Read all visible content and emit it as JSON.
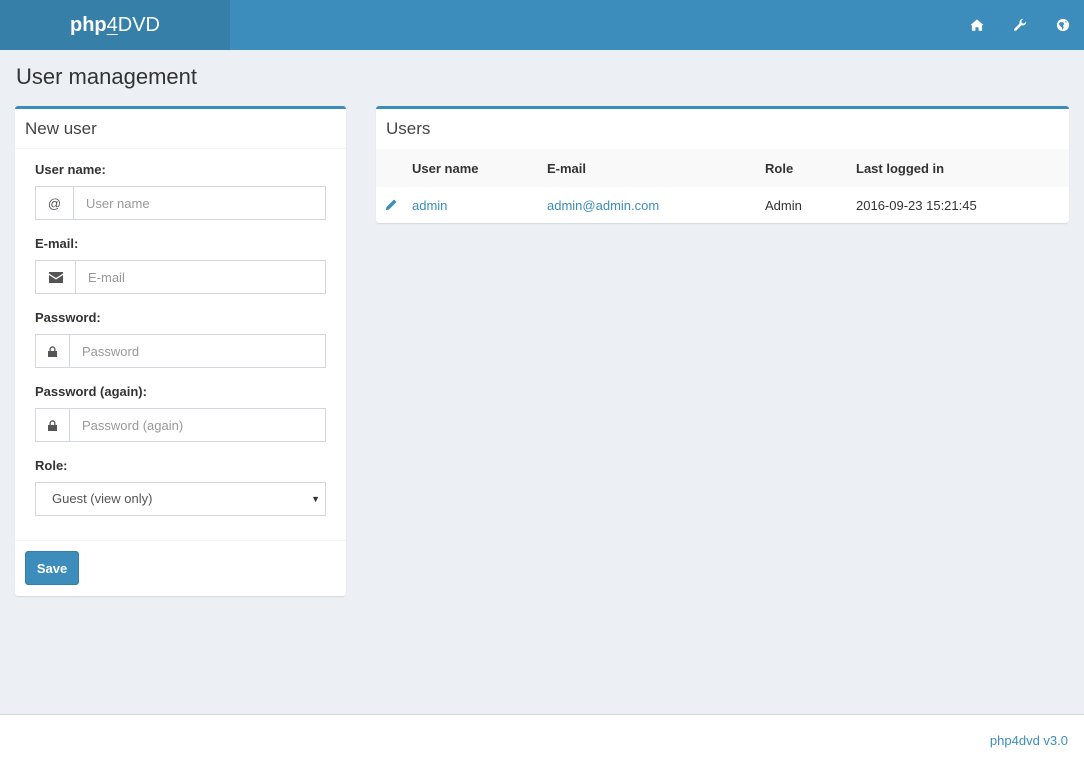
{
  "header": {
    "brand_bold": "php",
    "brand_four": "4",
    "brand_rest": "DVD",
    "icons": [
      "home-icon",
      "wrench-icon",
      "globe-icon"
    ]
  },
  "page": {
    "title": "User management"
  },
  "new_user": {
    "title": "New user",
    "username": {
      "label": "User name:",
      "addon": "@",
      "placeholder": "User name"
    },
    "email": {
      "label": "E-mail:",
      "placeholder": "E-mail"
    },
    "password": {
      "label": "Password:",
      "placeholder": "Password"
    },
    "password_again": {
      "label": "Password (again):",
      "placeholder": "Password (again)"
    },
    "role": {
      "label": "Role:",
      "selected": "Guest (view only)"
    },
    "save_label": "Save"
  },
  "users": {
    "title": "Users",
    "columns": [
      "User name",
      "E-mail",
      "Role",
      "Last logged in"
    ],
    "rows": [
      {
        "username": "admin",
        "email": "admin@admin.com",
        "role": "Admin",
        "last_login": "2016-09-23 15:21:45"
      }
    ]
  },
  "footer": {
    "version": "php4dvd v3.0"
  },
  "colors": {
    "primary": "#3c8dbc",
    "brand_bg": "#367fa9",
    "page_bg": "#ecf0f5"
  }
}
